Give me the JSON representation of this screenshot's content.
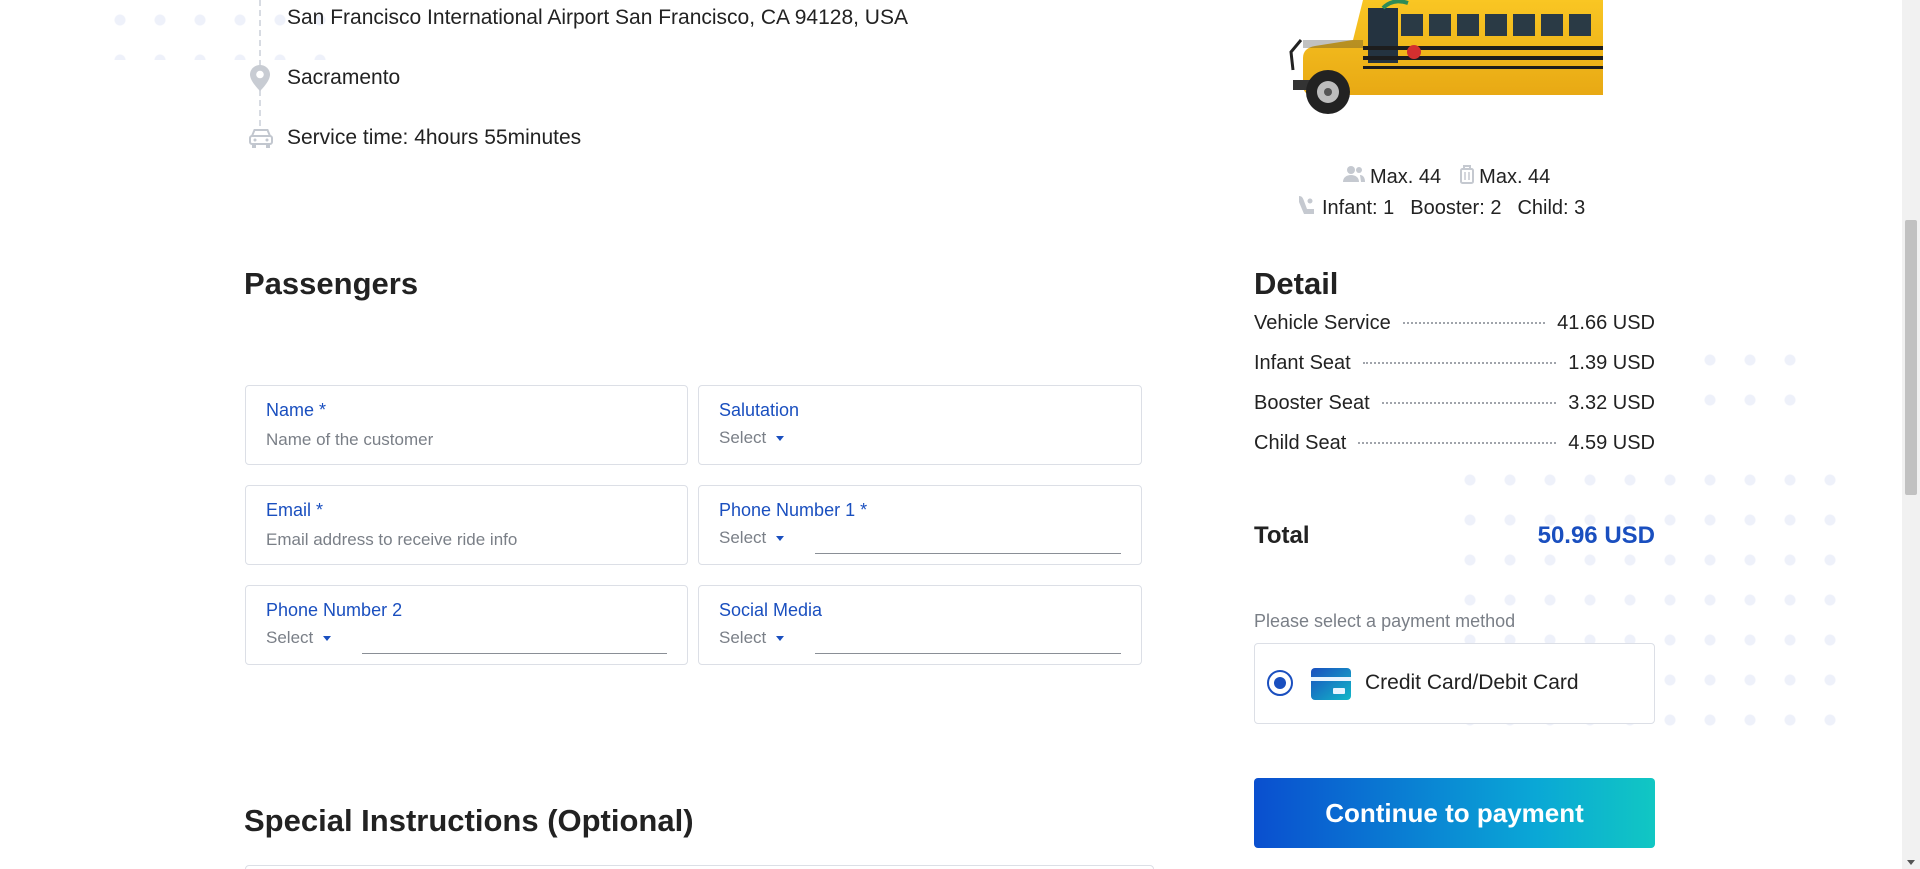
{
  "route": {
    "pickup": "San Francisco International Airport San Francisco, CA 94128, USA",
    "dropoff": "Sacramento",
    "service_time": "Service time: 4hours 55minutes",
    "icons": [
      "location-pin-icon",
      "car-icon"
    ]
  },
  "vehicle": {
    "max_passengers": "Max. 44",
    "max_luggage": "Max. 44",
    "infant": "Infant: 1",
    "booster": "Booster: 2",
    "child": "Child: 3",
    "icons": [
      "passengers-icon",
      "luggage-icon",
      "child-seat-icon"
    ]
  },
  "passengers": {
    "title": "Passengers",
    "name_label": "Name *",
    "name_placeholder": "Name of the customer",
    "salutation_label": "Salutation",
    "salutation_value": "Select",
    "email_label": "Email *",
    "email_placeholder": "Email address to receive ride info",
    "phone1_label": "Phone Number 1 *",
    "phone1_code": "Select",
    "phone2_label": "Phone Number 2",
    "phone2_code": "Select",
    "social_label": "Social Media",
    "social_value": "Select"
  },
  "special": {
    "title": "Special Instructions (Optional)"
  },
  "detail": {
    "title": "Detail",
    "rows": [
      {
        "label": "Vehicle Service",
        "value": "41.66 USD"
      },
      {
        "label": "Infant Seat",
        "value": "1.39 USD"
      },
      {
        "label": "Booster Seat",
        "value": "3.32 USD"
      },
      {
        "label": "Child Seat",
        "value": "4.59 USD"
      }
    ],
    "total_label": "Total",
    "total_value": "50.96 USD"
  },
  "payment": {
    "hint": "Please select a payment method",
    "method": "Credit Card/Debit Card",
    "continue_label": "Continue to payment"
  },
  "colors": {
    "accent": "#1a4fbf",
    "button_start": "#0a4fcf",
    "button_end": "#11c7c3"
  }
}
